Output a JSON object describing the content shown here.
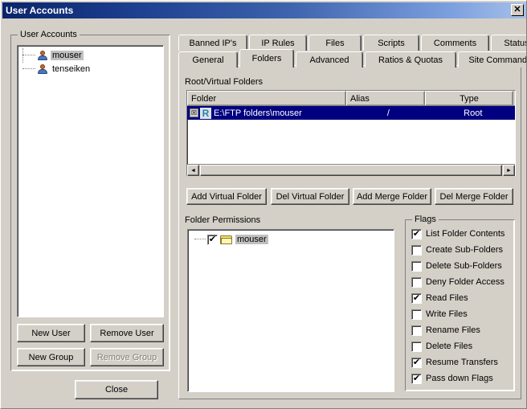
{
  "window": {
    "title": "User Accounts",
    "close_icon": "close-icon",
    "close_glyph": "✕"
  },
  "left_panel": {
    "group_label": "User Accounts",
    "users": [
      {
        "name": "mouser",
        "selected": true
      },
      {
        "name": "tenseiken",
        "selected": false
      }
    ],
    "buttons": {
      "new_user": "New User",
      "remove_user": "Remove User",
      "new_group": "New Group",
      "remove_group": "Remove Group",
      "remove_group_disabled": true
    }
  },
  "dialog_buttons": {
    "close": "Close"
  },
  "tabs": {
    "row1": [
      {
        "label": "Banned IP's",
        "active": false
      },
      {
        "label": "IP Rules",
        "active": false
      },
      {
        "label": "Files",
        "active": false
      },
      {
        "label": "Scripts",
        "active": false
      },
      {
        "label": "Comments",
        "active": false
      },
      {
        "label": "Status",
        "active": false
      }
    ],
    "row2": [
      {
        "label": "General",
        "active": false
      },
      {
        "label": "Folders",
        "active": true
      },
      {
        "label": "Advanced",
        "active": false
      },
      {
        "label": "Ratios & Quotas",
        "active": false
      },
      {
        "label": "Site Commands",
        "active": false
      }
    ]
  },
  "root_virtual_folders": {
    "label": "Root/Virtual Folders",
    "columns": [
      "Folder",
      "Alias",
      "Type"
    ],
    "rows": [
      {
        "marker": "☒",
        "type_icon": "R",
        "folder": "E:\\FTP folders\\mouser",
        "alias": "/",
        "type": "Root",
        "selected": true
      }
    ],
    "scrollbar": {
      "left_arrow": "◄",
      "right_arrow": "►"
    }
  },
  "folder_actions": {
    "add_virtual": "Add Virtual Folder",
    "del_virtual": "Del Virtual Folder",
    "add_merge": "Add Merge Folder",
    "del_merge": "Del Merge Folder"
  },
  "folder_permissions": {
    "label": "Folder Permissions",
    "items": [
      {
        "name": "mouser",
        "checked": true,
        "selected": true
      }
    ]
  },
  "flags": {
    "label": "Flags",
    "items": [
      {
        "label": "List Folder Contents",
        "checked": true
      },
      {
        "label": "Create Sub-Folders",
        "checked": false
      },
      {
        "label": "Delete Sub-Folders",
        "checked": false
      },
      {
        "label": "Deny Folder Access",
        "checked": false
      },
      {
        "label": "Read Files",
        "checked": true
      },
      {
        "label": "Write Files",
        "checked": false
      },
      {
        "label": "Rename Files",
        "checked": false
      },
      {
        "label": "Delete Files",
        "checked": false
      },
      {
        "label": "Resume Transfers",
        "checked": true
      },
      {
        "label": "Pass down Flags",
        "checked": true
      }
    ],
    "check_glyph": "✔"
  },
  "colors": {
    "face": "#d4d0c8",
    "title_start": "#0a246a",
    "title_end": "#a6c0e8",
    "selection": "#000080",
    "folder_yellow": "#f5e17a"
  }
}
